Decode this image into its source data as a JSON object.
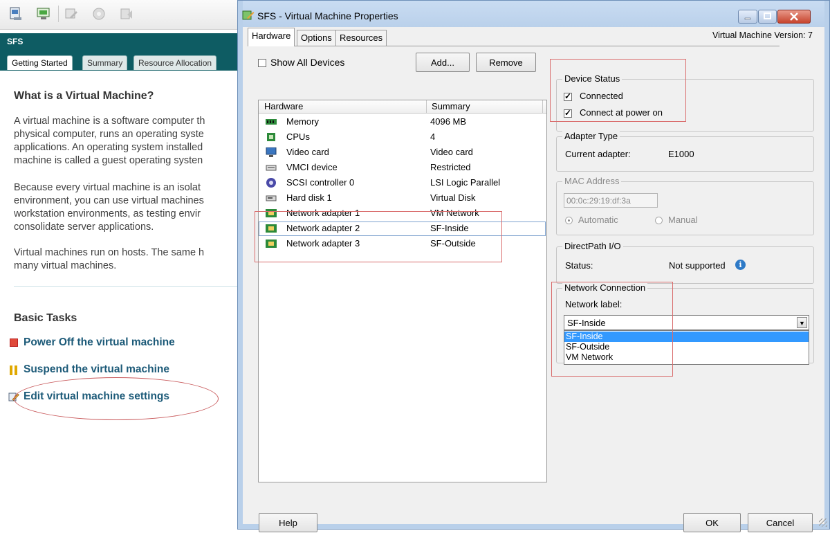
{
  "background": {
    "toolbar_icons": [
      "console-icon",
      "open-console-icon",
      "edit-settings-icon",
      "snapshot-icon",
      "migrate-icon"
    ],
    "vm_name": "SFS",
    "tabs": [
      "Getting Started",
      "Summary",
      "Resource Allocation"
    ],
    "heading": "What is a Virtual Machine?",
    "para1": [
      "A virtual machine is a software computer th",
      "physical computer, runs an operating syste",
      "applications. An operating system installed",
      "machine is called a guest operating systen"
    ],
    "para2": [
      "Because every virtual machine is an isolat",
      "environment, you can use virtual machines",
      "workstation environments, as testing envir",
      "consolidate server applications."
    ],
    "para3": [
      "Virtual machines run on hosts. The same h",
      "many virtual machines."
    ],
    "basic_tasks_title": "Basic Tasks",
    "tasks": [
      {
        "label": "Power Off the virtual machine",
        "icon": "power-off-icon"
      },
      {
        "label": "Suspend the virtual machine",
        "icon": "suspend-icon"
      },
      {
        "label": "Edit virtual machine settings",
        "icon": "edit-settings-icon"
      }
    ]
  },
  "dialog": {
    "title": "SFS - Virtual Machine Properties",
    "tabs": [
      "Hardware",
      "Options",
      "Resources"
    ],
    "version": "Virtual Machine Version: 7",
    "show_all_devices": "Show All Devices",
    "add_button": "Add...",
    "remove_button": "Remove",
    "columns": {
      "hardware": "Hardware",
      "summary": "Summary"
    },
    "hardware": [
      {
        "name": "Memory",
        "summary": "4096 MB",
        "icon": "memory-icon"
      },
      {
        "name": "CPUs",
        "summary": "4",
        "icon": "cpu-icon"
      },
      {
        "name": "Video card",
        "summary": "Video card",
        "icon": "video-card-icon"
      },
      {
        "name": "VMCI device",
        "summary": "Restricted",
        "icon": "vmci-device-icon"
      },
      {
        "name": "SCSI controller 0",
        "summary": "LSI Logic Parallel",
        "icon": "scsi-controller-icon"
      },
      {
        "name": "Hard disk 1",
        "summary": "Virtual Disk",
        "icon": "hard-disk-icon"
      },
      {
        "name": "Network adapter 1",
        "summary": "VM Network",
        "icon": "network-adapter-icon"
      },
      {
        "name": "Network adapter 2",
        "summary": "SF-Inside",
        "icon": "network-adapter-icon"
      },
      {
        "name": "Network adapter 3",
        "summary": "SF-Outside",
        "icon": "network-adapter-icon"
      }
    ],
    "selected_row": "Network adapter 2",
    "device_status": {
      "title": "Device Status",
      "connected": "Connected",
      "connect_power_on": "Connect at power on"
    },
    "adapter_type": {
      "title": "Adapter Type",
      "label": "Current adapter:",
      "value": "E1000"
    },
    "mac_address": {
      "title": "MAC Address",
      "value": "00:0c:29:19:df:3a",
      "automatic": "Automatic",
      "manual": "Manual"
    },
    "directpath": {
      "title": "DirectPath I/O",
      "label": "Status:",
      "value": "Not supported"
    },
    "network_connection": {
      "title": "Network Connection",
      "label": "Network label:",
      "selected": "SF-Inside",
      "options": [
        "SF-Inside",
        "SF-Outside",
        "VM Network"
      ]
    },
    "help_button": "Help",
    "ok_button": "OK",
    "cancel_button": "Cancel"
  },
  "colors": {
    "vm_header": "#0e5c63",
    "task_link": "#1c5a78",
    "highlight_box": "#d96c6c",
    "selection": "#3399ff"
  }
}
